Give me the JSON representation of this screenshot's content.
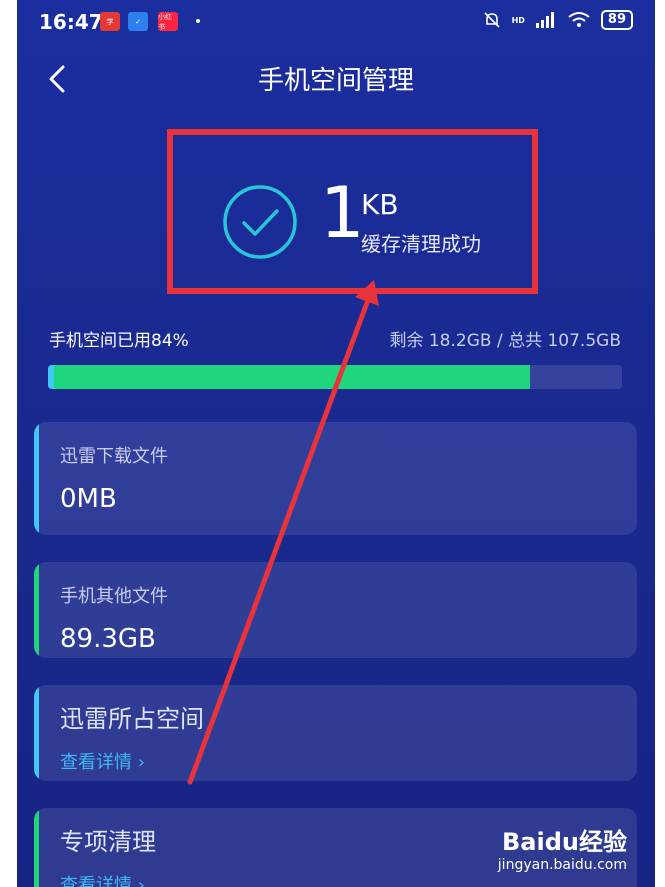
{
  "status_bar": {
    "time": "16:47",
    "apps": [
      {
        "text": "学",
        "color": "#e53935"
      },
      {
        "text": "✓",
        "color": "#2f7ff0"
      },
      {
        "text": "小红书",
        "color": "#ff2442"
      }
    ],
    "network": "HD",
    "battery": "89"
  },
  "header": {
    "title": "手机空间管理"
  },
  "result": {
    "amount": "1",
    "unit": "KB",
    "message": "缓存清理成功"
  },
  "usage": {
    "used_label": "手机空间已用84%",
    "remain_label": "剩余 18.2GB / 总共 107.5GB",
    "used_fraction": 0.84
  },
  "cards": [
    {
      "label": "迅雷下载文件",
      "value": "0MB",
      "accent": "#42c8f5"
    },
    {
      "label": "手机其他文件",
      "value": "89.3GB",
      "accent": "#1fd67c"
    },
    {
      "title": "迅雷所占空间",
      "link": "查看详情 ›",
      "accent": "#42c8f5"
    },
    {
      "title": "专项清理",
      "link": "查看详情 ›",
      "accent": "#1fd67c"
    }
  ],
  "watermark": {
    "logo": "Baidu经验",
    "site": "jingyan.baidu.com"
  },
  "colors": {
    "annotation": "#e8333b",
    "check": "#28c6d9"
  }
}
